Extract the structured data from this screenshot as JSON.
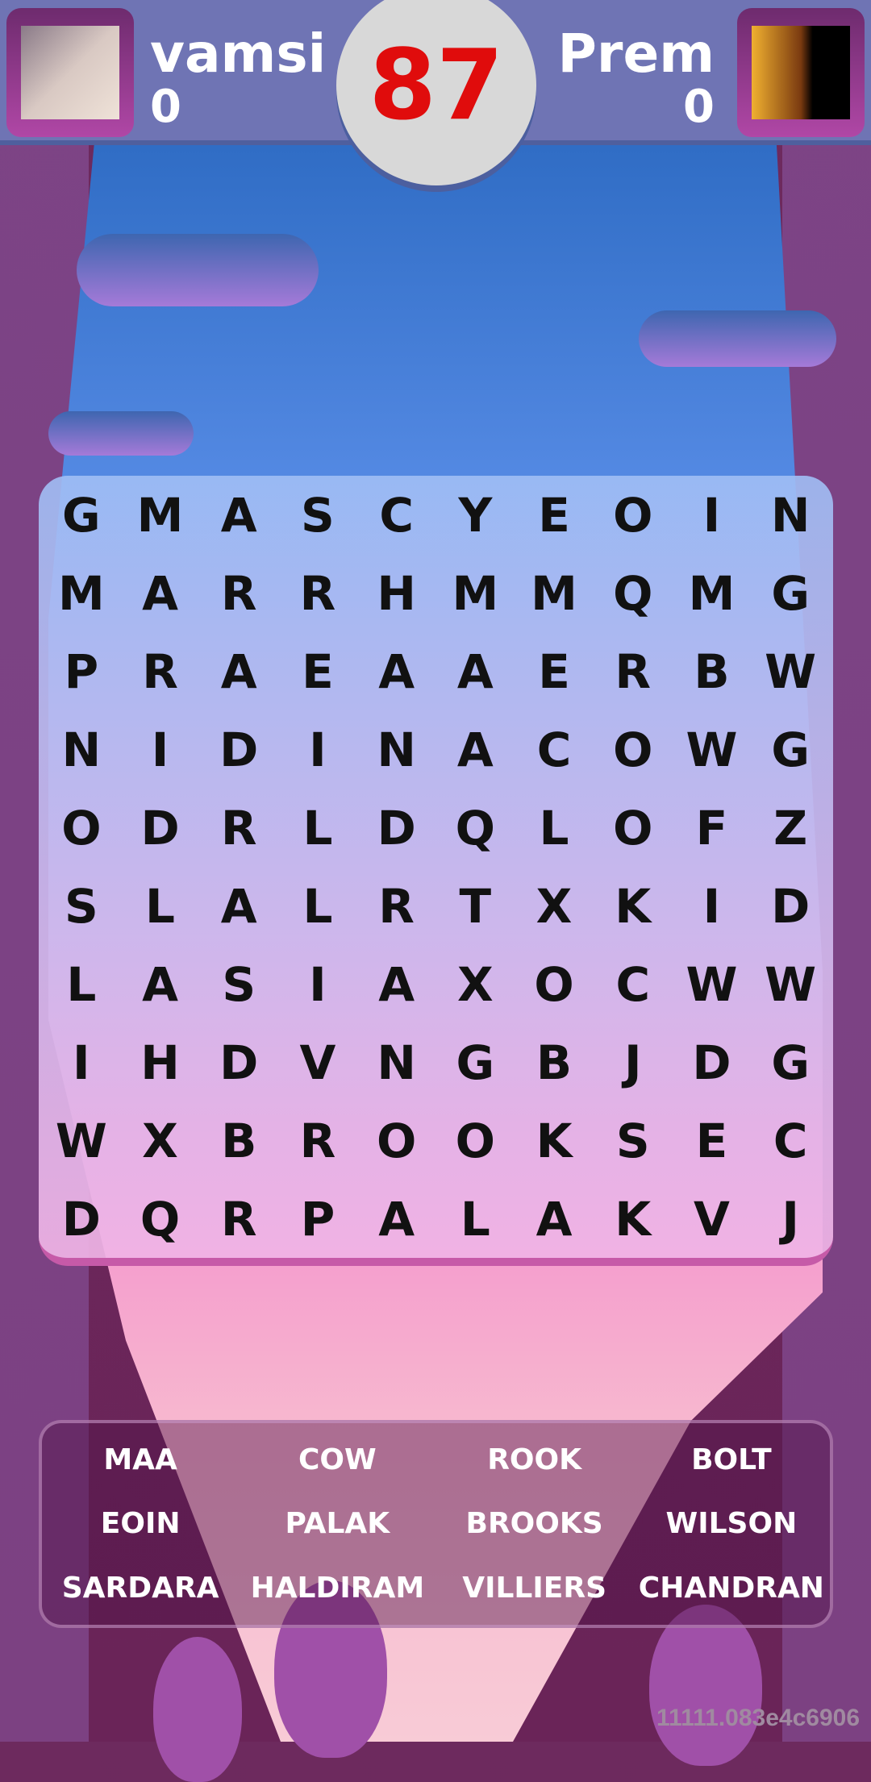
{
  "players": [
    {
      "name": "vamsi",
      "score": "0"
    },
    {
      "name": "Prem",
      "score": "0"
    }
  ],
  "timer": "87",
  "grid": [
    [
      "G",
      "M",
      "A",
      "S",
      "C",
      "Y",
      "E",
      "O",
      "I",
      "N"
    ],
    [
      "M",
      "A",
      "R",
      "R",
      "H",
      "M",
      "M",
      "Q",
      "M",
      "G"
    ],
    [
      "P",
      "R",
      "A",
      "E",
      "A",
      "A",
      "E",
      "R",
      "B",
      "W"
    ],
    [
      "N",
      "I",
      "D",
      "I",
      "N",
      "A",
      "C",
      "O",
      "W",
      "G"
    ],
    [
      "O",
      "D",
      "R",
      "L",
      "D",
      "Q",
      "L",
      "O",
      "F",
      "Z"
    ],
    [
      "S",
      "L",
      "A",
      "L",
      "R",
      "T",
      "X",
      "K",
      "I",
      "D"
    ],
    [
      "L",
      "A",
      "S",
      "I",
      "A",
      "X",
      "O",
      "C",
      "W",
      "W"
    ],
    [
      "I",
      "H",
      "D",
      "V",
      "N",
      "G",
      "B",
      "J",
      "D",
      "G"
    ],
    [
      "W",
      "X",
      "B",
      "R",
      "O",
      "O",
      "K",
      "S",
      "E",
      "C"
    ],
    [
      "D",
      "Q",
      "R",
      "P",
      "A",
      "L",
      "A",
      "K",
      "V",
      "J"
    ]
  ],
  "words": [
    "MAA",
    "COW",
    "ROOK",
    "BOLT",
    "EOIN",
    "PALAK",
    "BROOKS",
    "WILSON",
    "SARDARA",
    "HALDIRAM",
    "VILLIERS",
    "CHANDRAN"
  ],
  "version": "11111.083e4c6906",
  "colors": {
    "timer": "#e00c0c",
    "header": "#6f74b4"
  }
}
